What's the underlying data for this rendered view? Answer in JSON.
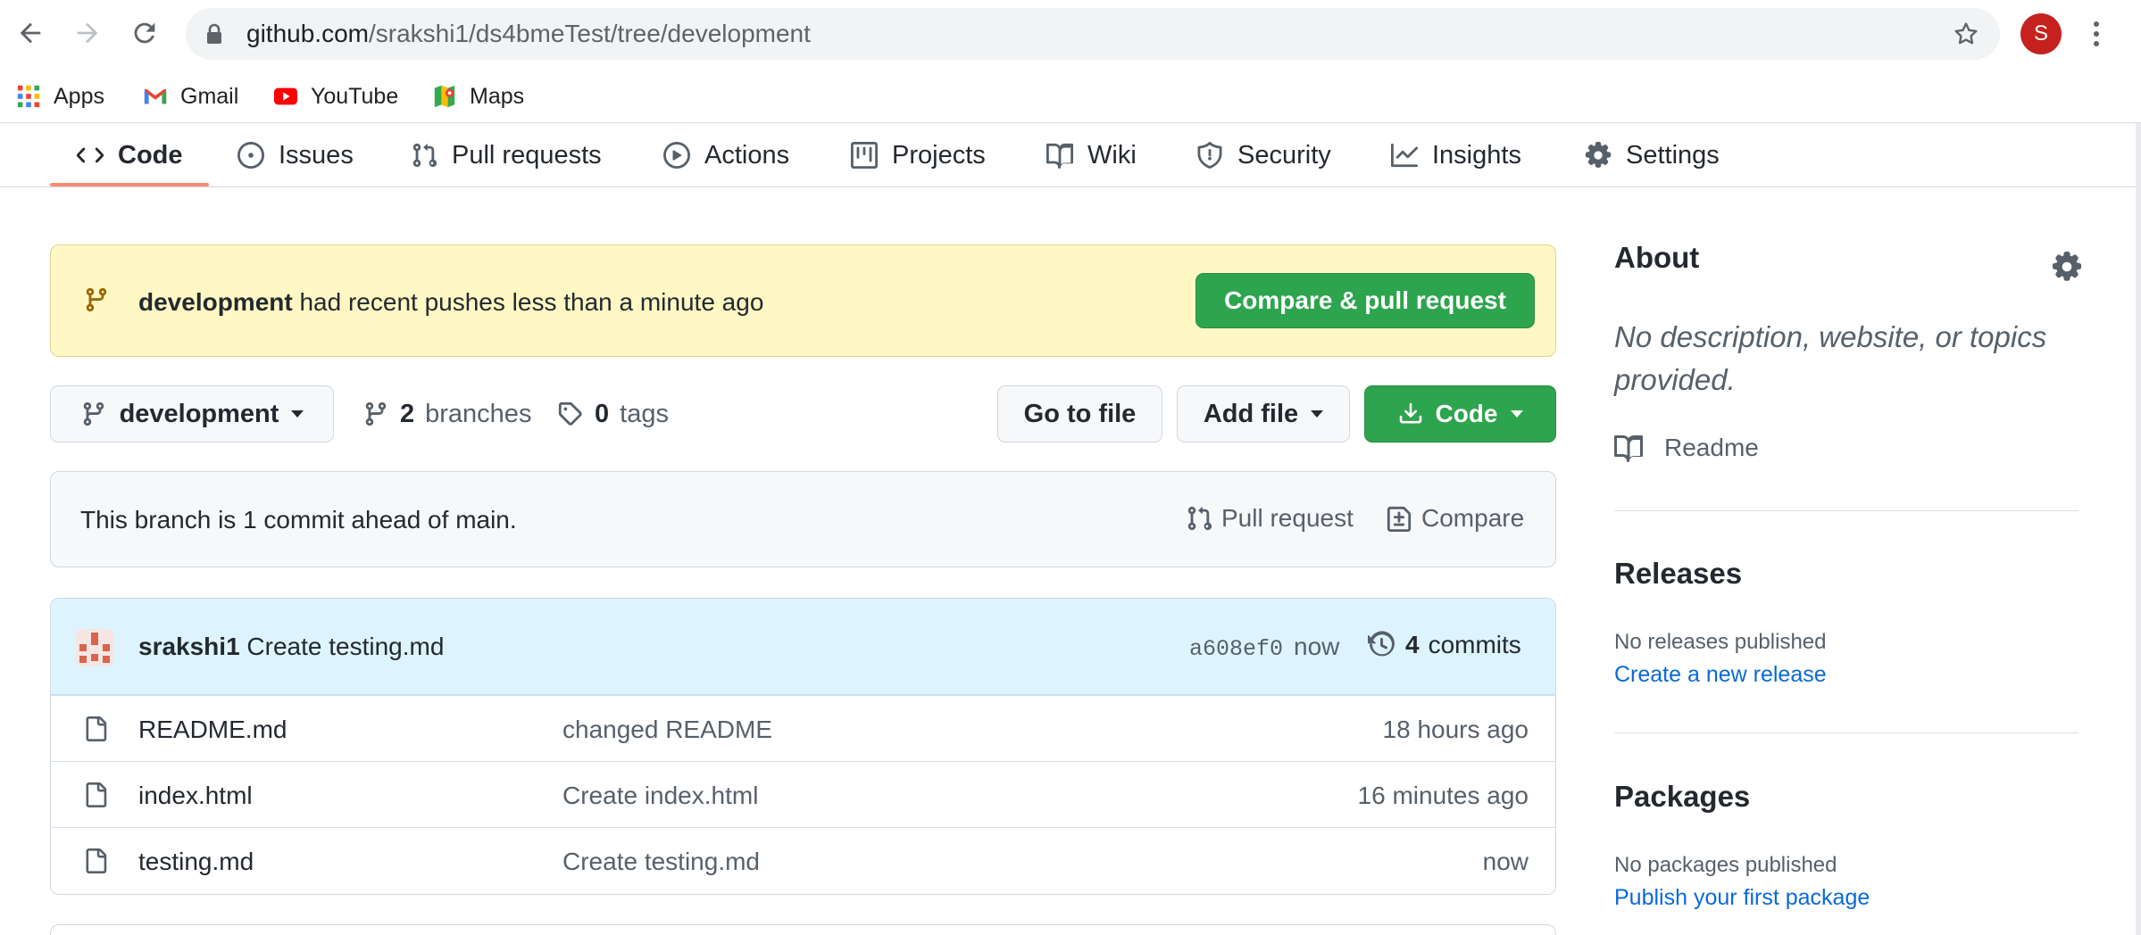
{
  "browser": {
    "url_host": "github.com",
    "url_path": "/srakshi1/ds4bmeTest/tree/development",
    "profile_initial": "S",
    "bookmarks": [
      {
        "label": "Apps",
        "icon": "apps-grid-icon"
      },
      {
        "label": "Gmail",
        "icon": "gmail-icon"
      },
      {
        "label": "YouTube",
        "icon": "youtube-icon"
      },
      {
        "label": "Maps",
        "icon": "maps-icon"
      }
    ]
  },
  "repo_nav": {
    "tabs": [
      {
        "label": "Code",
        "icon": "code-icon",
        "active": true
      },
      {
        "label": "Issues",
        "icon": "issue-icon"
      },
      {
        "label": "Pull requests",
        "icon": "pull-request-icon"
      },
      {
        "label": "Actions",
        "icon": "play-icon"
      },
      {
        "label": "Projects",
        "icon": "project-icon"
      },
      {
        "label": "Wiki",
        "icon": "book-icon"
      },
      {
        "label": "Security",
        "icon": "shield-icon"
      },
      {
        "label": "Insights",
        "icon": "graph-icon"
      },
      {
        "label": "Settings",
        "icon": "gear-icon"
      }
    ]
  },
  "banner": {
    "branch": "development",
    "message": "had recent pushes less than a minute ago",
    "button": "Compare & pull request"
  },
  "branch_bar": {
    "branch": "development",
    "branches_count": "2",
    "branches_label": "branches",
    "tags_count": "0",
    "tags_label": "tags",
    "go_to_file": "Go to file",
    "add_file": "Add file",
    "code": "Code"
  },
  "ahead": {
    "message": "This branch is 1 commit ahead of main.",
    "pull_request": "Pull request",
    "compare": "Compare"
  },
  "latest_commit": {
    "author": "srakshi1",
    "message": "Create testing.md",
    "sha": "a608ef0",
    "when": "now",
    "commit_count": "4",
    "commit_label": "commits"
  },
  "files": [
    {
      "name": "README.md",
      "message": "changed README",
      "age": "18 hours ago"
    },
    {
      "name": "index.html",
      "message": "Create index.html",
      "age": "16 minutes ago"
    },
    {
      "name": "testing.md",
      "message": "Create testing.md",
      "age": "now"
    }
  ],
  "sidebar": {
    "about_title": "About",
    "description": "No description, website, or topics provided.",
    "readme": "Readme",
    "releases_title": "Releases",
    "releases_empty": "No releases published",
    "releases_link": "Create a new release",
    "packages_title": "Packages",
    "packages_empty": "No packages published",
    "packages_link": "Publish your first package"
  },
  "colors": {
    "accent_green": "#2da44e",
    "link_blue": "#0969da",
    "tab_underline": "#fd8c73",
    "banner_bg": "#fff8c5"
  }
}
